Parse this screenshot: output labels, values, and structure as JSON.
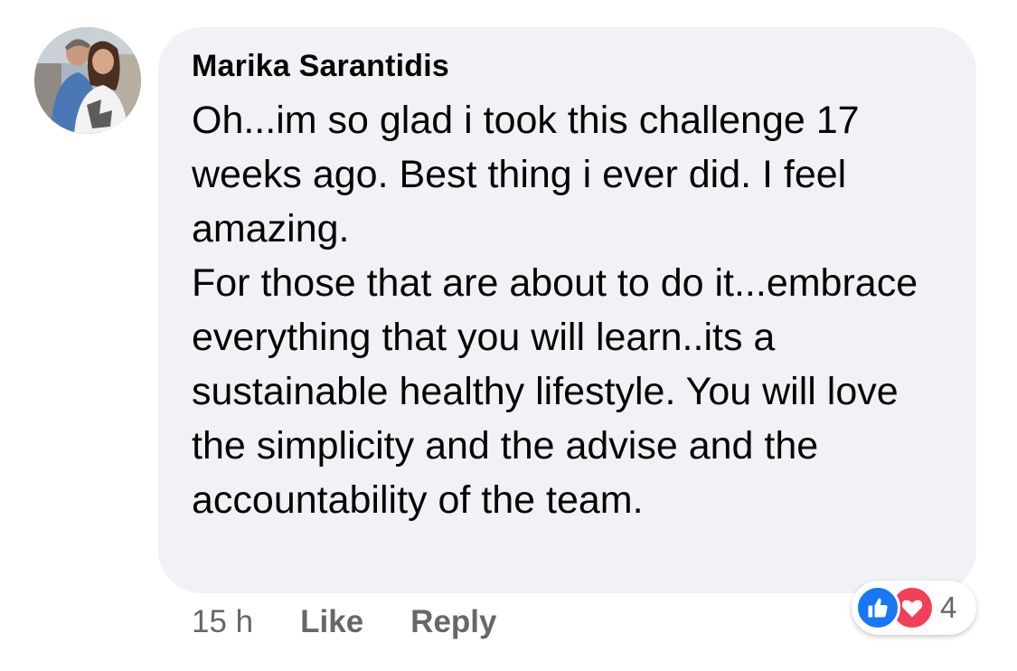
{
  "comment": {
    "author": "Marika Sarantidis",
    "body_lines": [
      "Oh...im so glad i took this challenge 17 weeks ago. Best thing i ever did. I feel amazing.",
      "For those that are about to do it...embrace everything that you will learn..its a sustainable healthy lifestyle. You will love the simplicity and the advise and the accountability of the team."
    ],
    "time": "15 h",
    "like_label": "Like",
    "reply_label": "Reply",
    "reactions": {
      "icons": [
        "like-icon",
        "love-icon"
      ],
      "count": "4"
    }
  },
  "colors": {
    "bubble": "#f0f2f5",
    "text": "#050505",
    "secondary_text": "#65676b",
    "like_blue": "#1877f2",
    "love_red": "#f33e58"
  }
}
